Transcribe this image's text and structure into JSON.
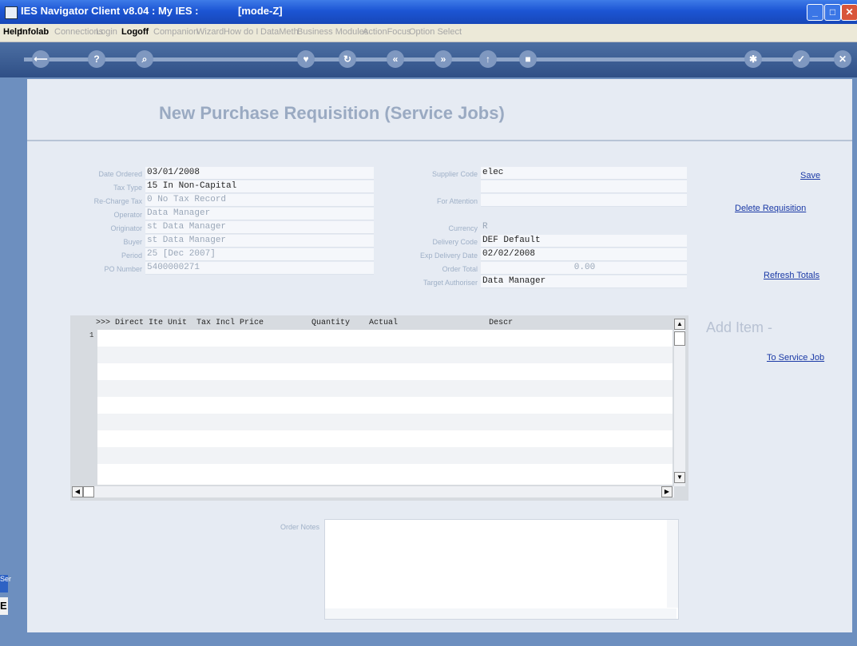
{
  "window": {
    "title": "IES Navigator Client v8.04 : My IES :",
    "mode": "[mode-Z]"
  },
  "menu": [
    {
      "label": "Help",
      "style": "bold"
    },
    {
      "label": "Infolab",
      "style": "bold"
    },
    {
      "label": "Connections",
      "style": "dim"
    },
    {
      "label": "Login",
      "style": "dim"
    },
    {
      "label": "Logoff",
      "style": "bold"
    },
    {
      "label": "Companion",
      "style": "dim"
    },
    {
      "label": "Wizard",
      "style": "dim"
    },
    {
      "label": "How do I",
      "style": "dim"
    },
    {
      "label": "DataMeth",
      "style": "dim"
    },
    {
      "label": "Business Modules",
      "style": "dim"
    },
    {
      "label": "ActionFocus",
      "style": "dim"
    },
    {
      "label": "Option Select",
      "style": "dim"
    }
  ],
  "toolbar": {
    "icons": [
      "back-arrow-icon",
      "help-icon",
      "search-icon",
      "heart-icon",
      "refresh-icon",
      "rewind-icon",
      "fast-forward-icon",
      "up-arrow-icon",
      "stop-icon",
      "gear-icon",
      "check-icon",
      "close-icon"
    ]
  },
  "form": {
    "heading": "New Purchase Requisition (Service Jobs)",
    "fields_left": [
      {
        "label": "Date Ordered",
        "value": "03/01/2008",
        "dim": false
      },
      {
        "label": "Tax Type",
        "value": "15 In Non-Capital",
        "dim": false
      },
      {
        "label": "Re-Charge Tax",
        "value": "0 No Tax Record",
        "dim": true
      },
      {
        "label": "Operator",
        "value": "Data Manager",
        "dim": true
      },
      {
        "label": "Originator",
        "value": "st Data Manager",
        "dim": true
      },
      {
        "label": "Buyer",
        "value": "st Data Manager",
        "dim": true
      },
      {
        "label": "Period",
        "value": "25  [Dec 2007]",
        "dim": true
      },
      {
        "label": "PO Number",
        "value": "5400000271",
        "dim": true
      }
    ],
    "fields_right": [
      {
        "label": "Supplier Code",
        "value": "elec",
        "dim": false
      },
      {
        "label": "",
        "value": "",
        "dim": false
      },
      {
        "label": "For Attention",
        "value": "",
        "dim": false
      },
      {
        "label": "Currency",
        "value": "R",
        "dim": true
      },
      {
        "label": "Delivery Code",
        "value": "DEF Default",
        "dim": false
      },
      {
        "label": "Exp Delivery Date",
        "value": "02/02/2008",
        "dim": false
      },
      {
        "label": "Order Total",
        "value": "0.00",
        "dim": true
      },
      {
        "label": "Target Authoriser",
        "value": "Data Manager",
        "dim": false
      }
    ],
    "links": {
      "save": "Save",
      "delete": "Delete Requisition",
      "refresh": "Refresh Totals",
      "to_service_job": "To Service Job"
    },
    "add_item": "Add Item -",
    "grid": {
      "header": ">>> Direct Ite Unit  Tax Incl Price          Quantity    Actual                   Descr",
      "row_number": "1"
    },
    "order_notes_label": "Order Notes"
  },
  "side": {
    "tab1": "Ser",
    "tab2": "E"
  }
}
